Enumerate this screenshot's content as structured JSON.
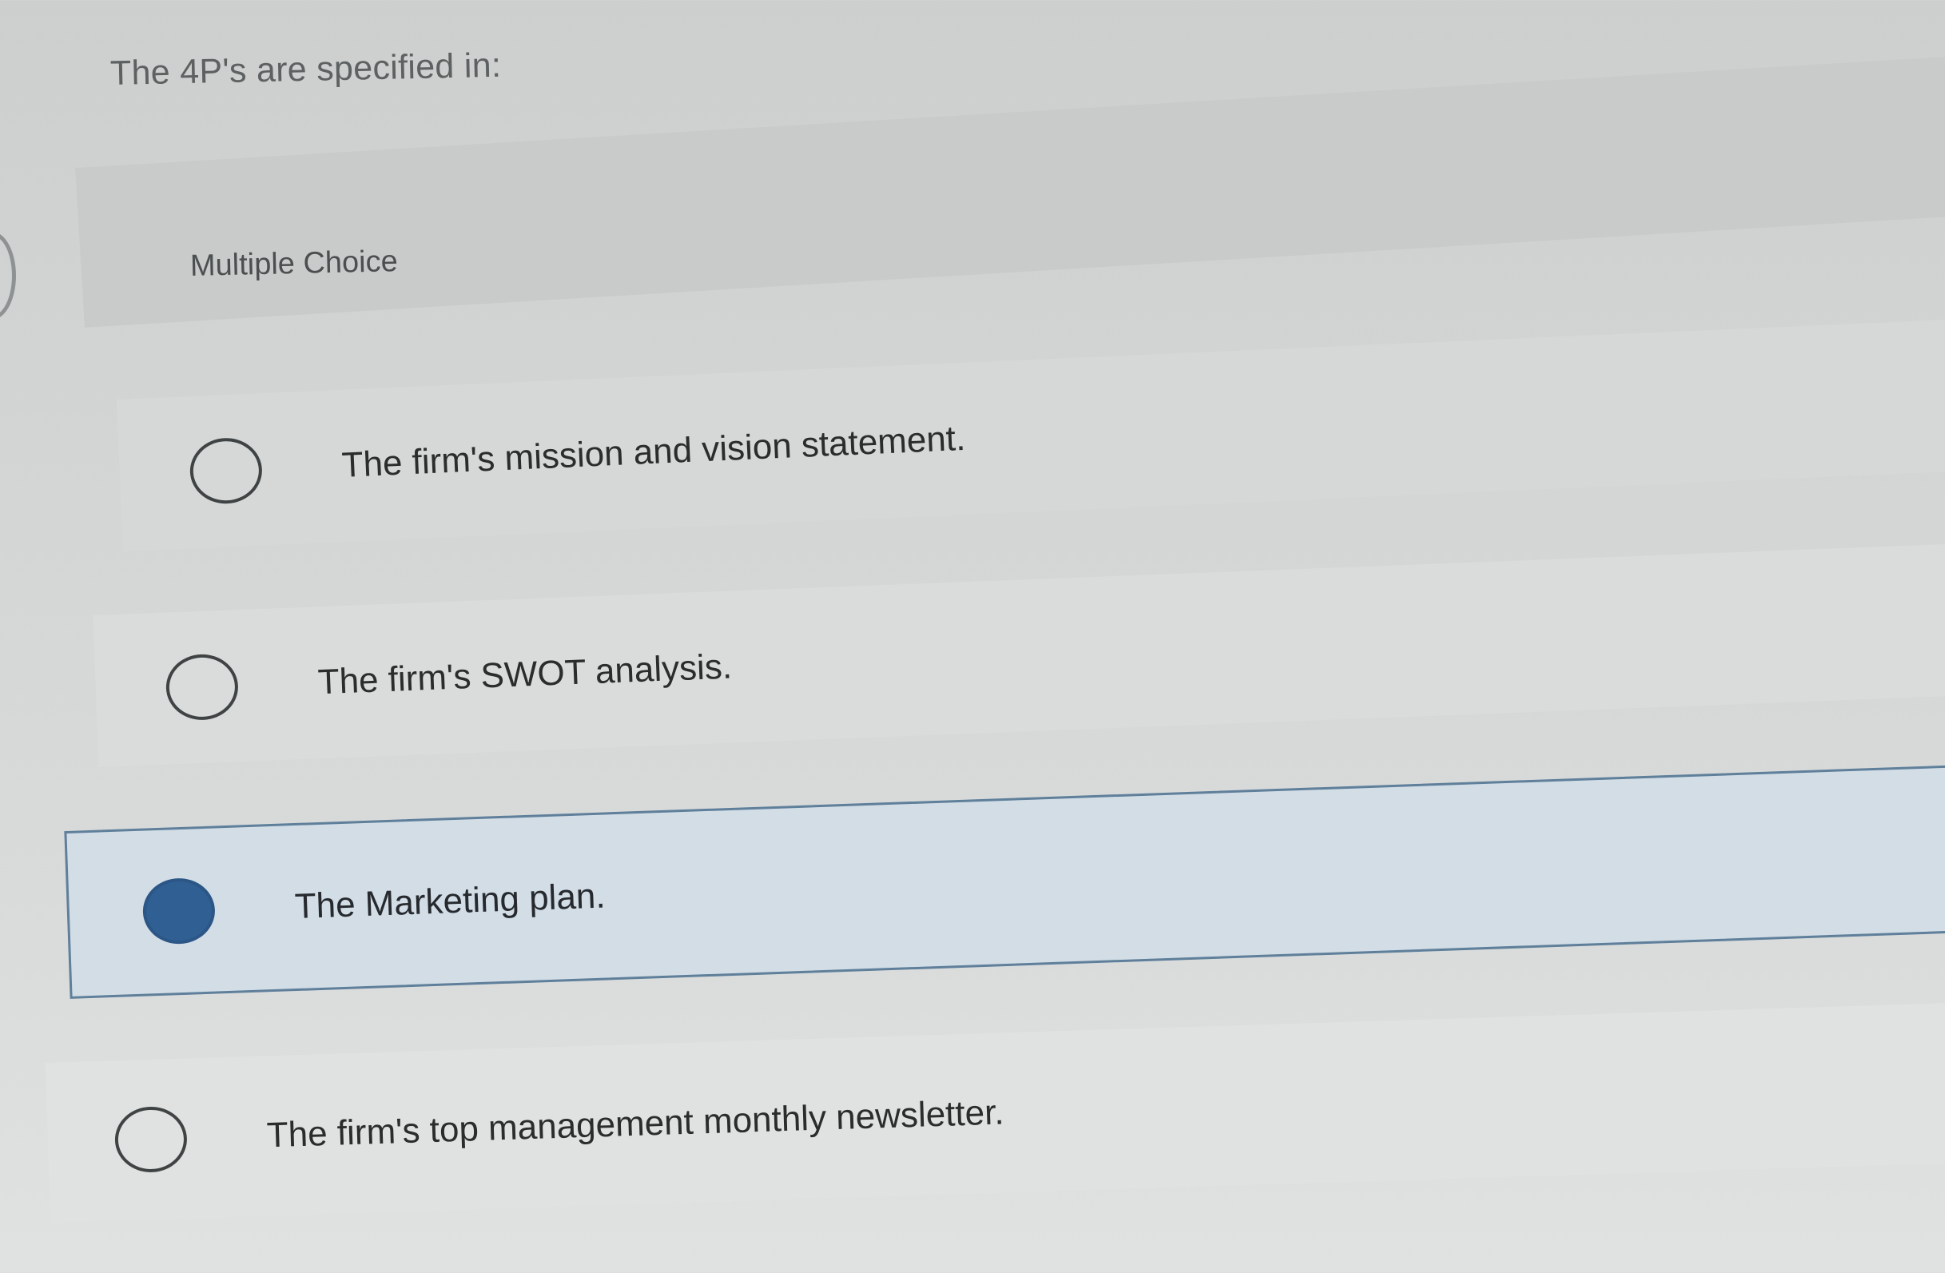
{
  "question": {
    "text": "The 4P's are specified in:"
  },
  "question_type": "Multiple Choice",
  "options": [
    {
      "label": "The firm's mission and vision statement.",
      "selected": false
    },
    {
      "label": "The firm's SWOT analysis.",
      "selected": false
    },
    {
      "label": "The Marketing plan.",
      "selected": true
    },
    {
      "label": "The firm's top management monthly newsletter.",
      "selected": false
    }
  ],
  "colors": {
    "selected_radio": "#2f5f93",
    "selected_row_background": "#d2dde6",
    "selected_row_border": "#5f7f9a",
    "text": "#2b2d2d"
  }
}
